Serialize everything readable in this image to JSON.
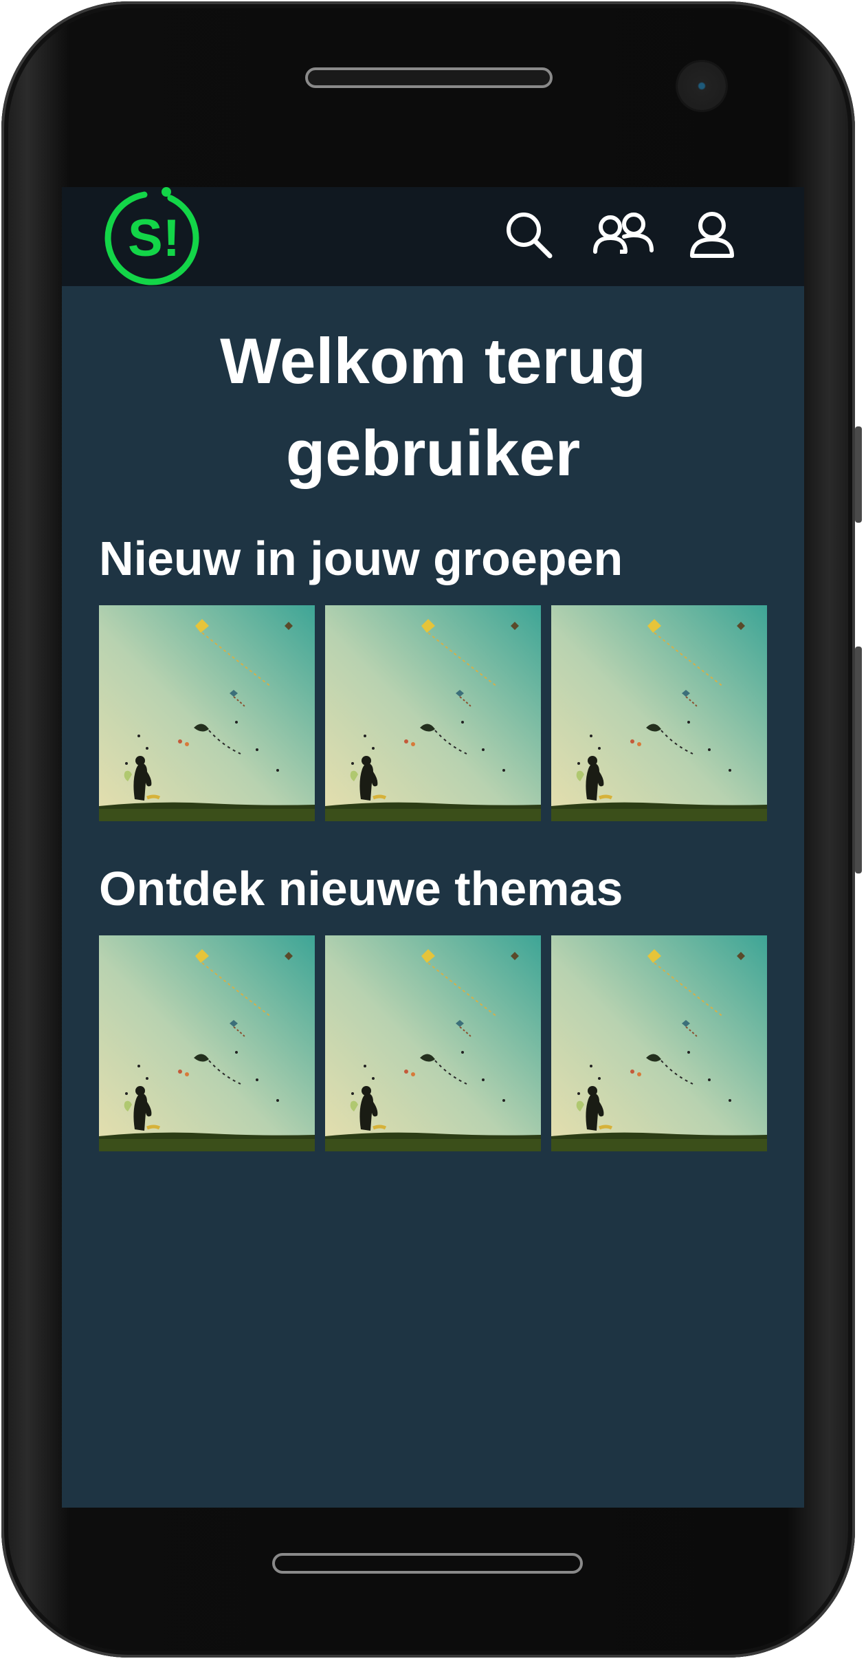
{
  "header": {
    "logo_text": "S!",
    "icons": [
      "search-icon",
      "groups-icon",
      "profile-icon"
    ]
  },
  "colors": {
    "background": "#1e3443",
    "header": "#101820",
    "brand_green": "#13d548"
  },
  "welcome": {
    "line1": "Welkom terug",
    "line2": "gebruiker"
  },
  "sections": [
    {
      "title": "Nieuw in jouw groepen",
      "items": [
        "kite-photo",
        "kite-photo",
        "kite-photo"
      ]
    },
    {
      "title": "Ontdek nieuwe themas",
      "items": [
        "kite-photo",
        "kite-photo",
        "kite-photo"
      ]
    }
  ]
}
